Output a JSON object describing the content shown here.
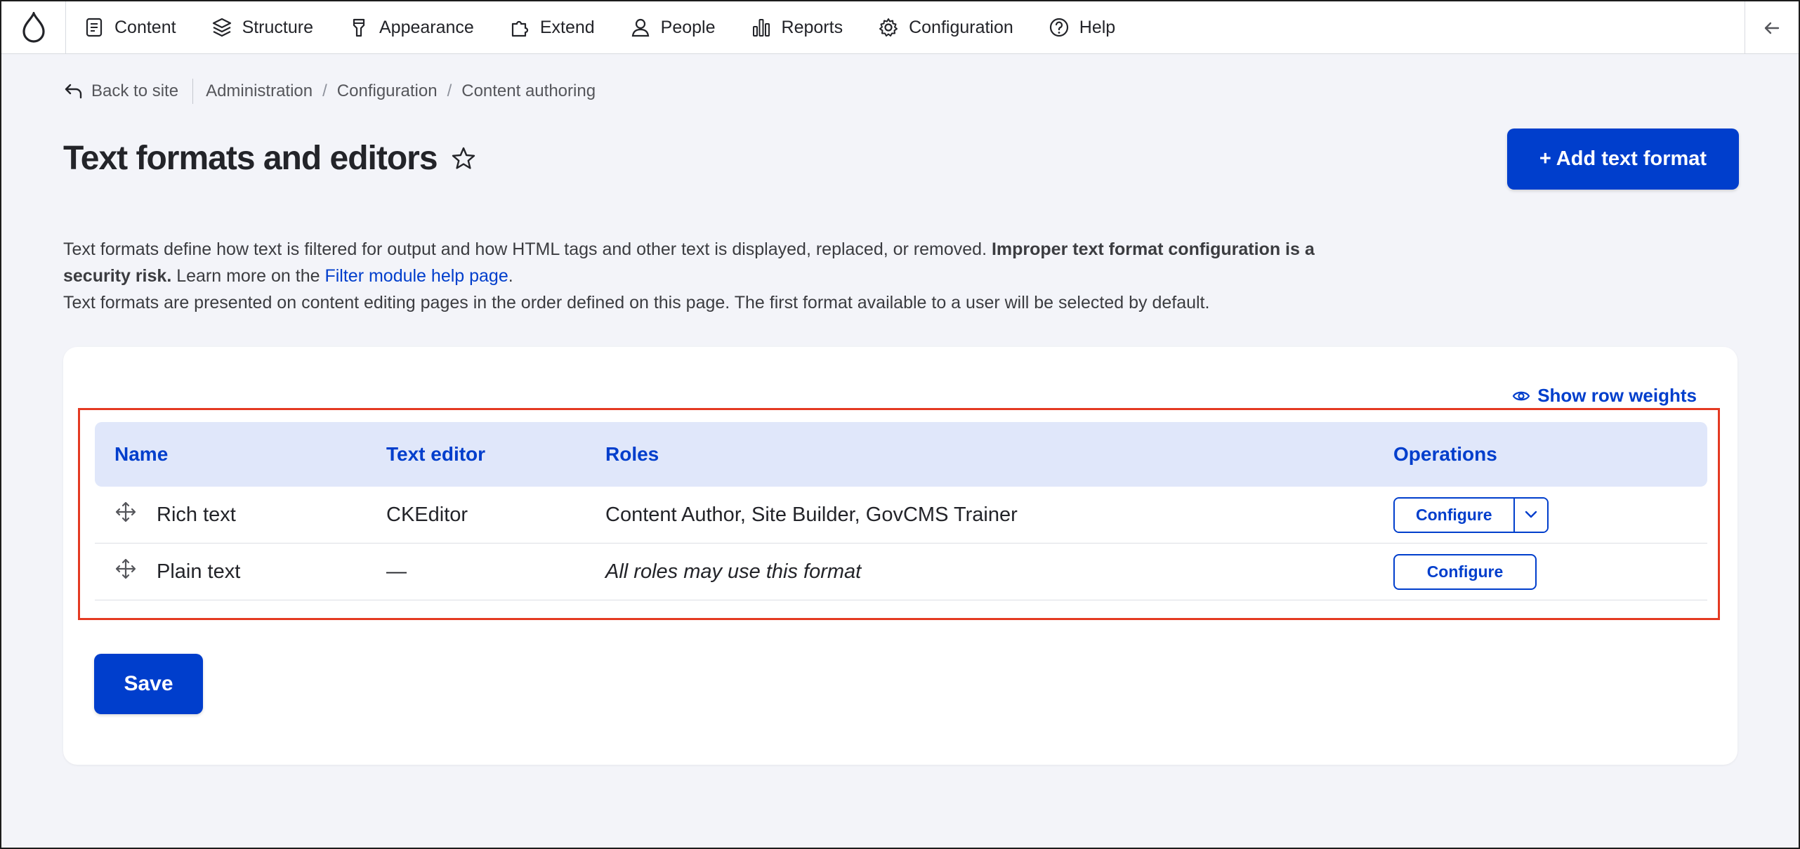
{
  "toolbar": {
    "nav": [
      {
        "label": "Content",
        "icon": "document-icon"
      },
      {
        "label": "Structure",
        "icon": "layers-icon"
      },
      {
        "label": "Appearance",
        "icon": "brush-icon"
      },
      {
        "label": "Extend",
        "icon": "puzzle-icon"
      },
      {
        "label": "People",
        "icon": "person-icon"
      },
      {
        "label": "Reports",
        "icon": "bar-chart-icon"
      },
      {
        "label": "Configuration",
        "icon": "gear-icon"
      },
      {
        "label": "Help",
        "icon": "help-icon"
      }
    ]
  },
  "breadcrumb": {
    "back": "Back to site",
    "items": [
      "Administration",
      "Configuration",
      "Content authoring"
    ]
  },
  "page": {
    "title": "Text formats and editors",
    "add_button": "+ Add text format"
  },
  "description": {
    "line1_start": "Text formats define how text is filtered for output and how HTML tags and other text is displayed, replaced, or removed. ",
    "line1_bold": "Improper text format configuration is a security risk.",
    "line1_mid": " Learn more on the ",
    "link": "Filter module help page",
    "line1_end": ".",
    "line2": "Text formats are presented on content editing pages in the order defined on this page. The first format available to a user will be selected by default."
  },
  "table": {
    "show_weights": "Show row weights",
    "headers": {
      "name": "Name",
      "editor": "Text editor",
      "roles": "Roles",
      "operations": "Operations"
    },
    "rows": [
      {
        "name": "Rich text",
        "editor": "CKEditor",
        "roles": "Content Author, Site Builder, GovCMS Trainer",
        "operation": "Configure"
      },
      {
        "name": "Plain text",
        "editor": "—",
        "roles": "All roles may use this format",
        "operation": "Configure"
      }
    ]
  },
  "save_label": "Save",
  "colors": {
    "accent": "#003ecc",
    "highlight": "#e43a22",
    "header_bg": "#e0e7fa"
  }
}
